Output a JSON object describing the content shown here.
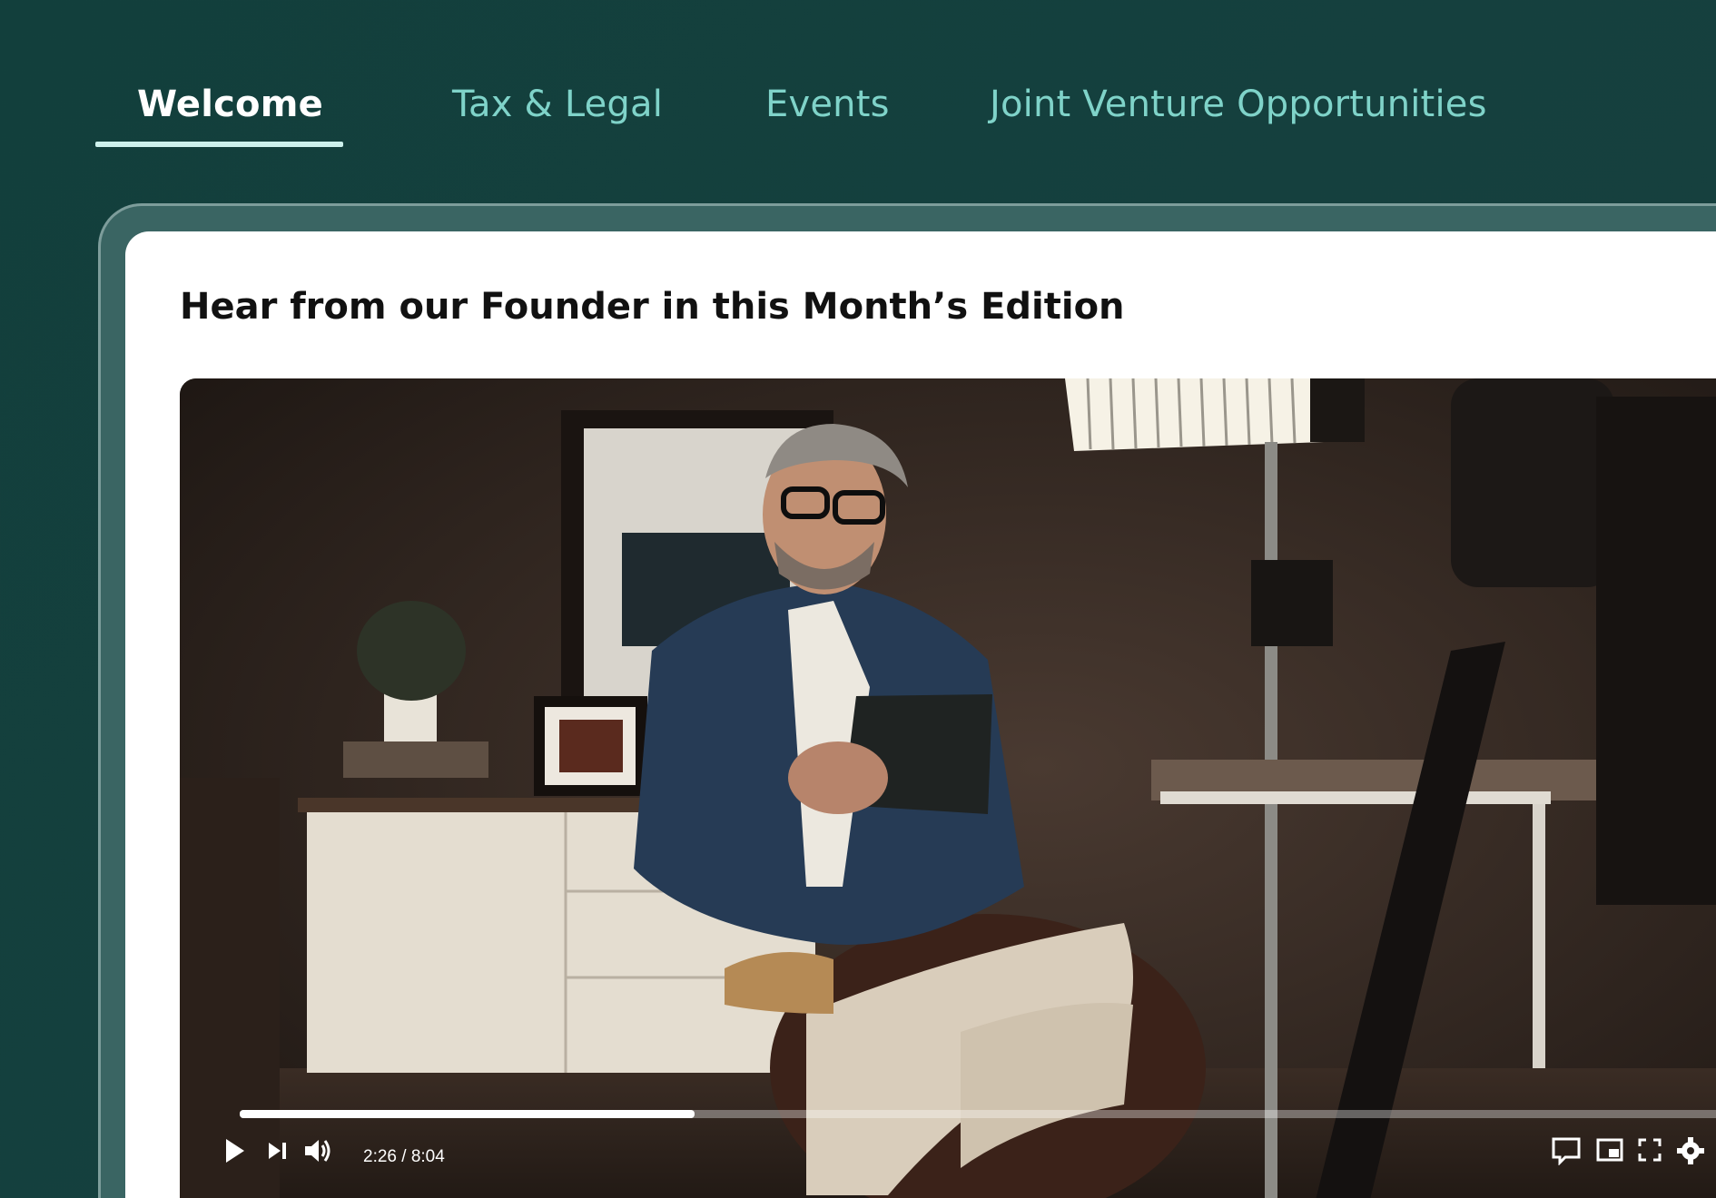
{
  "tabs": [
    {
      "label": "Welcome",
      "active": true
    },
    {
      "label": "Tax & Legal",
      "active": false
    },
    {
      "label": "Events",
      "active": false
    },
    {
      "label": "Joint Venture Opportunities",
      "active": false
    }
  ],
  "card": {
    "title": "Hear from our Founder in this Month’s Edition"
  },
  "video": {
    "current_time": "2:26",
    "duration": "8:04",
    "time_display": "2:26 / 8:04",
    "progress_fraction": 0.302,
    "controls": [
      "play-icon",
      "next-icon",
      "volume-icon",
      "captions-icon",
      "miniplayer-icon",
      "fullscreen-icon",
      "settings-icon"
    ]
  },
  "colors": {
    "background": "#15403e",
    "tab_inactive": "#7fd3c9",
    "tab_active": "#ffffff",
    "underline": "#cdf1ec",
    "card": "#ffffff"
  }
}
